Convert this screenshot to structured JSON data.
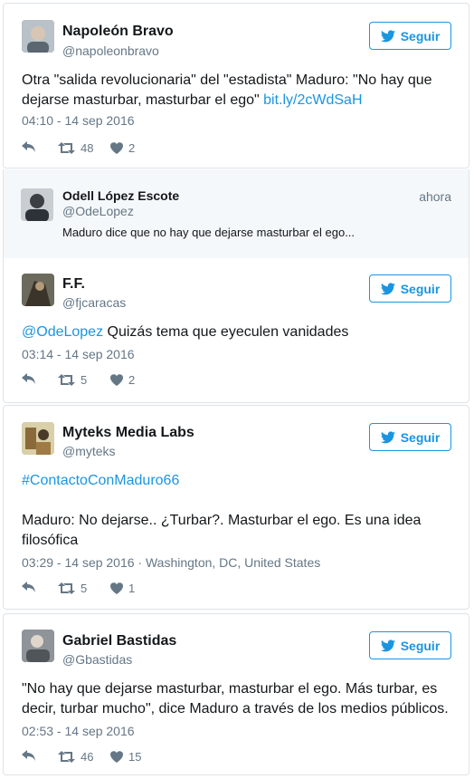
{
  "follow_label": "Seguir",
  "tweets": [
    {
      "name": "Napoleón Bravo",
      "handle": "@napoleonbravo",
      "text": "Otra \"salida revolucionaria\" del \"estadista\" Maduro: \"No hay que dejarse masturbar, masturbar el ego\" ",
      "link": "bit.ly/2cWdSaH",
      "meta": "04:10 - 14 sep 2016",
      "retweets": "48",
      "likes": "2"
    },
    {
      "name": "F.F.",
      "handle": "@fjcaracas",
      "mention": "@OdeLopez",
      "text": " Quizás tema que eyeculen vanidades",
      "meta": "03:14 - 14 sep 2016",
      "retweets": "5",
      "likes": "2"
    },
    {
      "name": "Myteks Media Labs",
      "handle": "@myteks",
      "hashtag": "#ContactoConMaduro66",
      "text": "Maduro: No dejarse.. ¿Turbar?. Masturbar el ego. Es una idea filosófica",
      "meta": "03:29 - 14 sep 2016 · Washington, DC, United States",
      "retweets": "5",
      "likes": "1"
    },
    {
      "name": "Gabriel Bastidas",
      "handle": "@Gbastidas",
      "text": "\"No hay que dejarse masturbar, masturbar el ego. Más turbar, es decir, turbar mucho\", dice Maduro a través de los medios públicos.",
      "meta": "02:53 - 14 sep 2016",
      "retweets": "46",
      "likes": "15"
    }
  ],
  "quoted": {
    "name": "Odell López Escote",
    "handle": "@OdeLopez",
    "time": "ahora",
    "text": "Maduro dice que no hay que dejarse masturbar el ego..."
  },
  "icons": {
    "follow": "twitter-bird-icon",
    "reply": "reply-icon",
    "retweet": "retweet-icon",
    "like": "heart-icon"
  },
  "colors": {
    "accent": "#1b95e0",
    "muted": "#657786",
    "text": "#14171a",
    "border": "#dfe3e6",
    "quote_bg": "#f5f8fa"
  }
}
